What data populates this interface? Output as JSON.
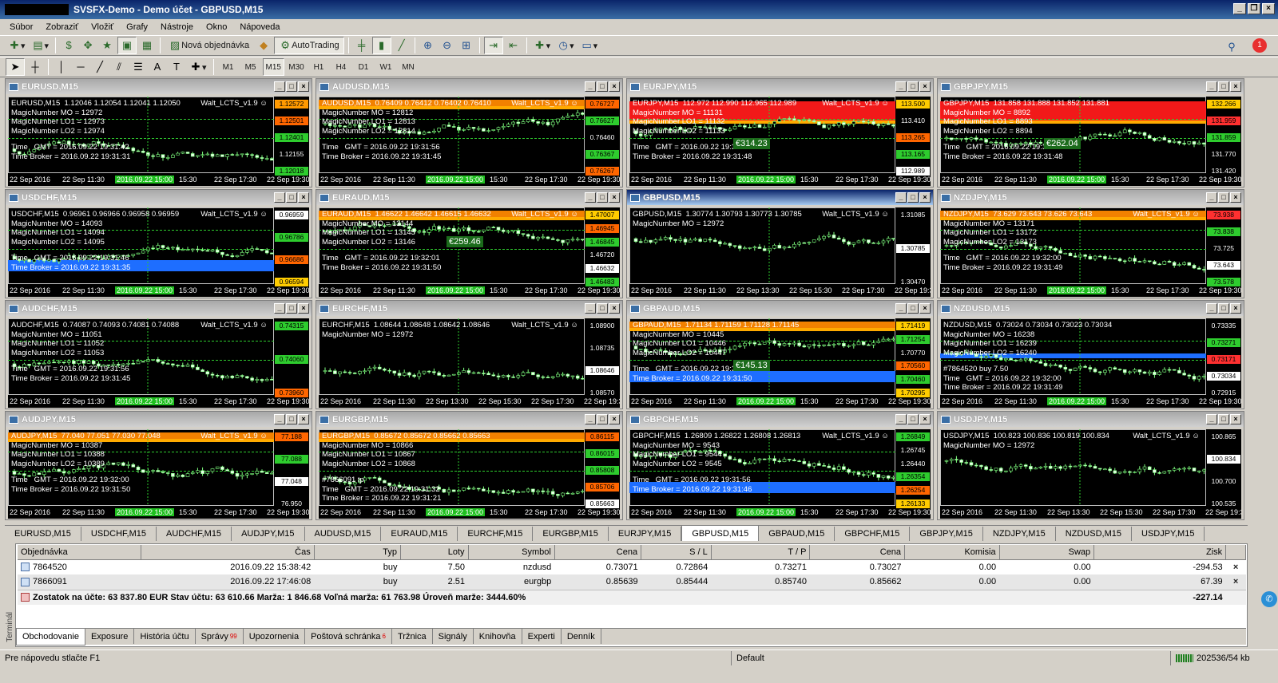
{
  "window": {
    "title": "SVSFX-Demo - Demo účet - GBPUSD,M15"
  },
  "menu": [
    "Súbor",
    "Zobraziť",
    "Vložiť",
    "Grafy",
    "Nástroje",
    "Okno",
    "Nápoveda"
  ],
  "toolbar": {
    "new_order": "Nová objednávka",
    "autotrading": "AutoTrading",
    "notifications": "1"
  },
  "timeframes": [
    "M1",
    "M5",
    "M15",
    "M30",
    "H1",
    "H4",
    "D1",
    "W1",
    "MN"
  ],
  "active_timeframe": "M15",
  "charts": [
    {
      "title": "EURUSD,M15",
      "info": "EURUSD,M15  1.12046 1.12054 1.12041 1.12050",
      "lines": [
        "MagicNumber MO = 12972",
        "MagicNumber LO1 = 12973",
        "MagicNumber LO2 = 12974"
      ],
      "time": [
        "Time   GMT = 2016.09.22 19:31:42",
        "Time Broker = 2016.09.22 19:31:31"
      ],
      "indicator": "Walt_LCTS_v1.9",
      "prices": [
        {
          "v": "1.12572",
          "c": "#ff9900"
        },
        {
          "v": "1.12501",
          "c": "#ff6600"
        },
        {
          "v": "1.12401",
          "c": "#2ecc2e"
        },
        {
          "v": "1.12155",
          "c": "plain"
        },
        {
          "v": "1.12018",
          "c": "#2ecc2e"
        }
      ],
      "times": [
        "22 Sep 2016",
        "22 Sep 11:30",
        "2016.09.22 15:00",
        "22 Sep 17:30",
        "22 Sep 19:30"
      ],
      "times_mid": "15:30",
      "profit": ""
    },
    {
      "title": "AUDUSD,M15",
      "info": "AUDUSD,M15  0.76409 0.76412 0.76402 0.76410",
      "lines": [
        "MagicNumber MO = 12812",
        "MagicNumber LO1 = 12813",
        "MagicNumber LO2 = 12814"
      ],
      "time": [
        "Time   GMT = 2016.09.22 19:31:56",
        "Time Broker = 2016.09.22 19:31:45"
      ],
      "indicator": "Walt_LCTS_v1.9",
      "prices": [
        {
          "v": "0.76727",
          "c": "#ff6600"
        },
        {
          "v": "0.76627",
          "c": "#2ecc2e"
        },
        {
          "v": "0.76460",
          "c": "plain"
        },
        {
          "v": "0.76367",
          "c": "#2ecc2e"
        },
        {
          "v": "0.76267",
          "c": "#ff6600"
        }
      ],
      "times": [
        "22 Sep 2016",
        "22 Sep 11:30",
        "2016.09.22 15:00",
        "22 Sep 17:30",
        "22 Sep 19:30"
      ],
      "times_mid": "15:30",
      "profit": ""
    },
    {
      "title": "EURJPY,M15",
      "info": "EURJPY,M15  112.972 112.990 112.965 112.989",
      "lines": [
        "MagicNumber MO = 11131",
        "MagicNumber LO1 = 11132",
        "MagicNumber LO2 = 11133"
      ],
      "time": [
        "Time   GMT = 2016.09.22 19:31:59",
        "Time Broker = 2016.09.22 19:31:48"
      ],
      "indicator": "Walt_LCTS_v1.9",
      "prices": [
        {
          "v": "113.500",
          "c": "#ffcc00"
        },
        {
          "v": "113.410",
          "c": "plain"
        },
        {
          "v": "113.265",
          "c": "#ff6600"
        },
        {
          "v": "113.165",
          "c": "#2ecc2e"
        },
        {
          "v": "112.989",
          "c": "#ffffff"
        }
      ],
      "times": [
        "22 Sep 2016",
        "22 Sep 11:30",
        "2016.09.22 15:00",
        "22 Sep 17:30",
        "22 Sep 19:30"
      ],
      "times_mid": "15:30",
      "profit": "€314.23"
    },
    {
      "title": "GBPJPY,M15",
      "info": "GBPJPY,M15  131.858 131.888 131.852 131.881",
      "lines": [
        "MagicNumber MO = 8892",
        "MagicNumber LO1 = 8893",
        "MagicNumber LO2 = 8894"
      ],
      "time": [
        "Time   GMT = 2016.09.22 19:31:59",
        "Time Broker = 2016.09.22 19:31:48"
      ],
      "indicator": "",
      "prices": [
        {
          "v": "132.266",
          "c": "#ffcc00"
        },
        {
          "v": "131.959",
          "c": "#ff3030"
        },
        {
          "v": "131.859",
          "c": "#2ecc2e"
        },
        {
          "v": "131.770",
          "c": "plain"
        },
        {
          "v": "131.420",
          "c": "plain"
        }
      ],
      "times": [
        "22 Sep 2016",
        "22 Sep 11:30",
        "2016.09.22 15:00",
        "22 Sep 17:30",
        "22 Sep 19:30"
      ],
      "times_mid": "15:30",
      "profit": "€262.04"
    },
    {
      "title": "USDCHF,M15",
      "info": "USDCHF,M15  0.96961 0.96966 0.96958 0.96959",
      "lines": [
        "MagicNumber MO = 14093",
        "MagicNumber LO1 = 14094",
        "MagicNumber LO2 = 14095"
      ],
      "time": [
        "Time   GMT = 2016.09.22 19:31:46",
        "Time Broker = 2016.09.22 19:31:35"
      ],
      "indicator": "Walt_LCTS_v1.9",
      "prices": [
        {
          "v": "0.96959",
          "c": "#ffffff"
        },
        {
          "v": "0.96786",
          "c": "#2ecc2e"
        },
        {
          "v": "0.96686",
          "c": "#ff6600"
        },
        {
          "v": "0.96594",
          "c": "#ffcc00"
        }
      ],
      "times": [
        "22 Sep 2016",
        "22 Sep 11:30",
        "2016.09.22 15:00",
        "22 Sep 17:30",
        "22 Sep 19:30"
      ],
      "times_mid": "15:30",
      "profit": ""
    },
    {
      "title": "EURAUD,M15",
      "info": "EURAUD,M15  1.46622 1.46642 1.46615 1.46632",
      "lines": [
        "MagicNumber MO = 13144",
        "MagicNumber LO1 = 13145",
        "MagicNumber LO2 = 13146"
      ],
      "time": [
        "Time   GMT = 2016.09.22 19:32:01",
        "Time Broker = 2016.09.22 19:31:50"
      ],
      "indicator": "Walt_LCTS_v1.9",
      "prices": [
        {
          "v": "1.47007",
          "c": "#ffcc00"
        },
        {
          "v": "1.46945",
          "c": "#ff6600"
        },
        {
          "v": "1.46845",
          "c": "#2ecc2e"
        },
        {
          "v": "1.46720",
          "c": "plain"
        },
        {
          "v": "1.46632",
          "c": "#ffffff"
        },
        {
          "v": "1.46483",
          "c": "#2ecc2e"
        }
      ],
      "times": [
        "22 Sep 2016",
        "22 Sep 11:30",
        "2016.09.22 15:00",
        "22 Sep 17:30",
        "22 Sep 19:30"
      ],
      "times_mid": "15:30",
      "profit": "€259.46"
    },
    {
      "title": "GBPUSD,M15",
      "info": "GBPUSD,M15  1.30774 1.30793 1.30773 1.30785",
      "lines": [
        "MagicNumber MO = 12972"
      ],
      "time": [],
      "indicator": "Walt_LCTS_v1.9",
      "prices": [
        {
          "v": "1.31085",
          "c": "plain"
        },
        {
          "v": "1.30785",
          "c": "#ffffff"
        },
        {
          "v": "1.30470",
          "c": "plain"
        }
      ],
      "times": [
        "22 Sep 2016",
        "22 Sep 11:30",
        "22 Sep 13:30",
        "22 Sep 15:30",
        "22 Sep 17:30",
        "22 Sep 19:30"
      ],
      "times_mid": "",
      "profit": "",
      "active": true
    },
    {
      "title": "NZDJPY,M15",
      "info": "NZDJPY,M15  73.629 73.643 73.626 73.643",
      "lines": [
        "MagicNumber MO = 13171",
        "MagicNumber LO1 = 13172",
        "MagicNumber LO2 = 13173"
      ],
      "time": [
        "Time   GMT = 2016.09.22 19:32:00",
        "Time Broker = 2016.09.22 19:31:49"
      ],
      "indicator": "Walt_LCTS_v1.9",
      "prices": [
        {
          "v": "73.938",
          "c": "#ff3030"
        },
        {
          "v": "73.838",
          "c": "#2ecc2e"
        },
        {
          "v": "73.725",
          "c": "plain"
        },
        {
          "v": "73.643",
          "c": "#ffffff"
        },
        {
          "v": "73.578",
          "c": "#2ecc2e"
        }
      ],
      "times": [
        "22 Sep 2016",
        "22 Sep 11:30",
        "2016.09.22 15:00",
        "22 Sep 17:30",
        "22 Sep 19:30"
      ],
      "times_mid": "15:30",
      "profit": ""
    },
    {
      "title": "AUDCHF,M15",
      "info": "AUDCHF,M15  0.74087 0.74093 0.74081 0.74088",
      "lines": [
        "MagicNumber MO = 11051",
        "MagicNumber LO1 = 11052",
        "MagicNumber LO2 = 11053"
      ],
      "time": [
        "Time   GMT = 2016.09.22 19:31:56",
        "Time Broker = 2016.09.22 19:31:45"
      ],
      "indicator": "Walt_LCTS_v1.9",
      "prices": [
        {
          "v": "0.74315",
          "c": "#2ecc2e"
        },
        {
          "v": "0.74060",
          "c": "#2ecc2e"
        },
        {
          "v": "0.73960",
          "c": "#ff6600"
        }
      ],
      "times": [
        "22 Sep 2016",
        "22 Sep 11:30",
        "2016.09.22 15:00",
        "22 Sep 17:30",
        "22 Sep 19:30"
      ],
      "times_mid": "15:30",
      "profit": ""
    },
    {
      "title": "EURCHF,M15",
      "info": "EURCHF,M15  1.08644 1.08648 1.08642 1.08646",
      "lines": [
        "MagicNumber MO = 12972"
      ],
      "time": [],
      "indicator": "Walt_LCTS_v1.9",
      "prices": [
        {
          "v": "1.08900",
          "c": "plain"
        },
        {
          "v": "1.08735",
          "c": "plain"
        },
        {
          "v": "1.08646",
          "c": "#ffffff"
        },
        {
          "v": "1.08570",
          "c": "plain"
        }
      ],
      "times": [
        "22 Sep 2016",
        "22 Sep 11:30",
        "22 Sep 13:30",
        "22 Sep 15:30",
        "22 Sep 17:30",
        "22 Sep 19:30"
      ],
      "times_mid": "",
      "profit": ""
    },
    {
      "title": "GBPAUD,M15",
      "info": "GBPAUD,M15  1.71134 1.71159 1.71128 1.71145",
      "lines": [
        "MagicNumber MO = 10445",
        "MagicNumber LO1 = 10446",
        "MagicNumber LO2 = 10447"
      ],
      "time": [
        "Time   GMT = 2016.09.22 19:32:00",
        "Time Broker = 2016.09.22 19:31:50"
      ],
      "indicator": "",
      "prices": [
        {
          "v": "1.71419",
          "c": "#ffcc00"
        },
        {
          "v": "1.71254",
          "c": "#2ecc2e"
        },
        {
          "v": "1.70770",
          "c": "plain"
        },
        {
          "v": "1.70560",
          "c": "#ff6600"
        },
        {
          "v": "1.70460",
          "c": "#2ecc2e"
        },
        {
          "v": "1.70295",
          "c": "#ffcc00"
        }
      ],
      "times": [
        "22 Sep 2016",
        "22 Sep 11:30",
        "2016.09.22 15:00",
        "22 Sep 17:30",
        "22 Sep 19:30"
      ],
      "times_mid": "15:30",
      "profit": "€145.13"
    },
    {
      "title": "NZDUSD,M15",
      "info": "NZDUSD,M15  0.73024 0.73034 0.73023 0.73034",
      "lines": [
        "MagicNumber MO = 16238",
        "MagicNumber LO1 = 16239",
        "MagicNumber LO2 = 16240"
      ],
      "time": [
        "Time   GMT = 2016.09.22 19:32:00",
        "Time Broker = 2016.09.22 19:31:49"
      ],
      "indicator": "",
      "order_label": "#7864520 buy 7.50",
      "prices": [
        {
          "v": "0.73335",
          "c": "plain"
        },
        {
          "v": "0.73271",
          "c": "#2ecc2e"
        },
        {
          "v": "0.73171",
          "c": "#ff3030"
        },
        {
          "v": "0.73034",
          "c": "#ffffff"
        },
        {
          "v": "0.72915",
          "c": "plain"
        }
      ],
      "times": [
        "22 Sep 2016",
        "22 Sep 11:30",
        "2016.09.22 15:00",
        "22 Sep 17:30",
        "22 Sep 19:30"
      ],
      "times_mid": "15:30",
      "profit": ""
    },
    {
      "title": "AUDJPY,M15",
      "info": "AUDJPY,M15  77.040 77.051 77.030 77.048",
      "lines": [
        "MagicNumber MO = 10387",
        "MagicNumber LO1 = 10388",
        "MagicNumber LO2 = 10389"
      ],
      "time": [
        "Time   GMT = 2016.09.22 19:32:00",
        "Time Broker = 2016.09.22 19:31:50"
      ],
      "indicator": "Walt_LCTS_v1.9",
      "prices": [
        {
          "v": "77.188",
          "c": "#ff6600"
        },
        {
          "v": "77.088",
          "c": "#2ecc2e"
        },
        {
          "v": "77.048",
          "c": "#ffffff"
        },
        {
          "v": "76.950",
          "c": "plain"
        }
      ],
      "times": [
        "22 Sep 2016",
        "22 Sep 11:30",
        "2016.09.22 15:00",
        "22 Sep 17:30",
        "22 Sep 19:30"
      ],
      "times_mid": "15:30",
      "profit": ""
    },
    {
      "title": "EURGBP,M15",
      "info": "EURGBP,M15  0.85672 0.85672 0.85662 0.85663",
      "lines": [
        "MagicNumber MO = 10866",
        "MagicNumber LO1 = 10867",
        "MagicNumber LO2 = 10868"
      ],
      "time": [
        "Time   GMT = 2016.09.22 19:31:32",
        "Time Broker = 2016.09.22 19:31:21"
      ],
      "indicator": "",
      "order_label": "#7866091 tp",
      "prices": [
        {
          "v": "0.86115",
          "c": "#ff6600"
        },
        {
          "v": "0.86015",
          "c": "#2ecc2e"
        },
        {
          "v": "0.85808",
          "c": "#2ecc2e"
        },
        {
          "v": "0.85706",
          "c": "#ff6600"
        },
        {
          "v": "0.85663",
          "c": "#ffffff"
        }
      ],
      "times": [
        "22 Sep 2016",
        "22 Sep 11:30",
        "2016.09.22 15:00",
        "22 Sep 17:30",
        "22 Sep 19:30"
      ],
      "times_mid": "15:30",
      "profit": ""
    },
    {
      "title": "GBPCHF,M15",
      "info": "GBPCHF,M15  1.26809 1.26822 1.26808 1.26813",
      "lines": [
        "MagicNumber MO = 9543",
        "MagicNumber LO1 = 9544",
        "MagicNumber LO2 = 9545"
      ],
      "time": [
        "Time   GMT = 2016.09.22 19:31:56",
        "Time Broker = 2016.09.22 19:31:46"
      ],
      "indicator": "Walt_LCTS_v1.9",
      "prices": [
        {
          "v": "1.26849",
          "c": "#2ecc2e"
        },
        {
          "v": "1.26745",
          "c": "plain"
        },
        {
          "v": "1.26440",
          "c": "plain"
        },
        {
          "v": "1.26354",
          "c": "#2ecc2e"
        },
        {
          "v": "1.26254",
          "c": "#ff6600"
        },
        {
          "v": "1.26133",
          "c": "#ffcc00"
        }
      ],
      "times": [
        "22 Sep 2016",
        "22 Sep 11:30",
        "2016.09.22 15:00",
        "22 Sep 17:30",
        "22 Sep 19:30"
      ],
      "times_mid": "15:30",
      "profit": ""
    },
    {
      "title": "USDJPY,M15",
      "info": "USDJPY,M15  100.823 100.836 100.819 100.834",
      "lines": [
        "MagicNumber MO = 12972"
      ],
      "time": [],
      "indicator": "Walt_LCTS_v1.9",
      "prices": [
        {
          "v": "100.865",
          "c": "plain"
        },
        {
          "v": "100.834",
          "c": "#ffffff"
        },
        {
          "v": "100.700",
          "c": "plain"
        },
        {
          "v": "100.535",
          "c": "plain"
        }
      ],
      "times": [
        "22 Sep 2016",
        "22 Sep 11:30",
        "22 Sep 13:30",
        "22 Sep 15:30",
        "22 Sep 17:30",
        "22 Sep 19:30"
      ],
      "times_mid": "",
      "profit": ""
    }
  ],
  "chart_tabs": [
    "EURUSD,M15",
    "USDCHF,M15",
    "AUDCHF,M15",
    "AUDJPY,M15",
    "AUDUSD,M15",
    "EURAUD,M15",
    "EURCHF,M15",
    "EURGBP,M15",
    "EURJPY,M15",
    "GBPUSD,M15",
    "GBPAUD,M15",
    "GBPCHF,M15",
    "GBPJPY,M15",
    "NZDJPY,M15",
    "NZDUSD,M15",
    "USDJPY,M15"
  ],
  "active_chart_tab": "GBPUSD,M15",
  "terminal": {
    "label": "Terminál",
    "headers": [
      "Objednávka",
      "Čas",
      "Typ",
      "Loty",
      "Symbol",
      "Cena",
      "S / L",
      "T / P",
      "Cena",
      "Komisia",
      "Swap",
      "Zisk"
    ],
    "rows": [
      [
        "7864520",
        "2016.09.22 15:38:42",
        "buy",
        "7.50",
        "nzdusd",
        "0.73071",
        "0.72864",
        "0.73271",
        "0.73027",
        "0.00",
        "0.00",
        "-294.53"
      ],
      [
        "7866091",
        "2016.09.22 17:46:08",
        "buy",
        "2.51",
        "eurgbp",
        "0.85639",
        "0.85444",
        "0.85740",
        "0.85662",
        "0.00",
        "0.00",
        "67.39"
      ]
    ],
    "balance": "Zostatok na účte: 63 837.80 EUR  Stav účtu: 63 610.66  Marža: 1 846.68  Voľná marža: 61 763.98  Úroveň marže: 3444.60%",
    "balance_profit": "-227.14",
    "close_symbol": "×"
  },
  "bottom_tabs": [
    {
      "label": "Obchodovanie",
      "badge": ""
    },
    {
      "label": "Exposure",
      "badge": ""
    },
    {
      "label": "História účtu",
      "badge": ""
    },
    {
      "label": "Správy",
      "badge": "99"
    },
    {
      "label": "Upozornenia",
      "badge": ""
    },
    {
      "label": "Poštová schránka",
      "badge": "6"
    },
    {
      "label": "Tržnica",
      "badge": ""
    },
    {
      "label": "Signály",
      "badge": ""
    },
    {
      "label": "Knihovňa",
      "badge": ""
    },
    {
      "label": "Experti",
      "badge": ""
    },
    {
      "label": "Denník",
      "badge": ""
    }
  ],
  "status": {
    "help": "Pre nápovedu stlačte F1",
    "profile": "Default",
    "traffic": "202536/54 kb"
  }
}
